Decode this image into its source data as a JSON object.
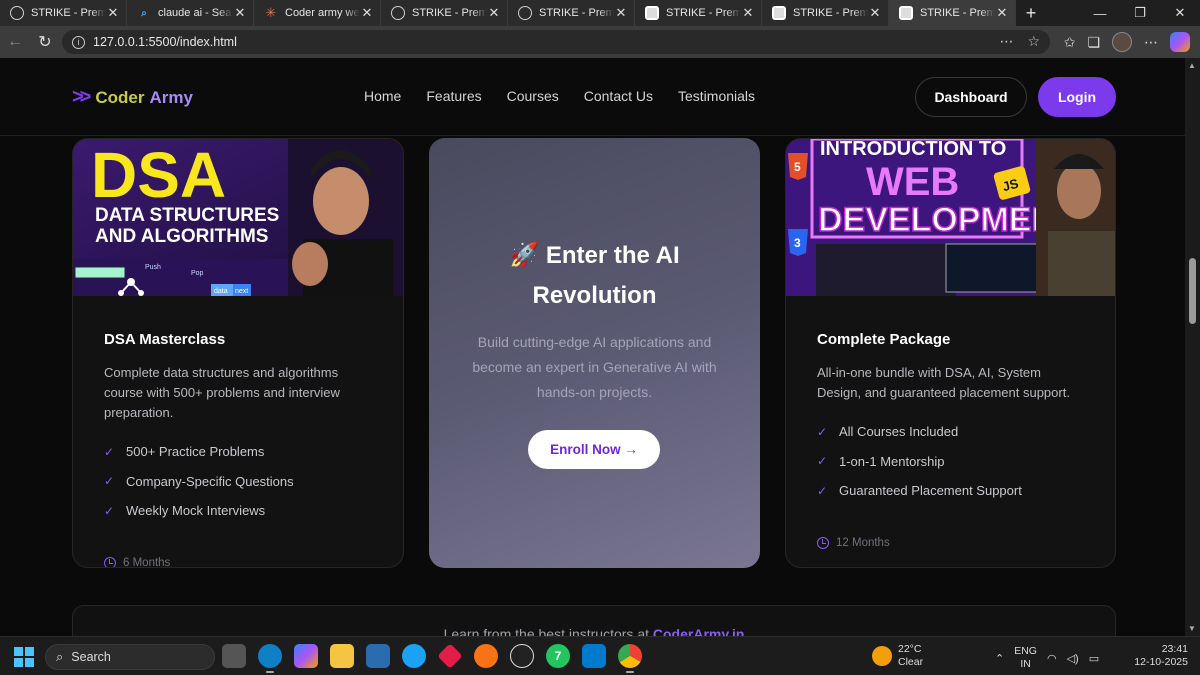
{
  "browser": {
    "tabs": [
      {
        "title": "STRIKE - Premium C",
        "icon": "globe-icon"
      },
      {
        "title": "claude ai - Search",
        "icon": "bing-icon"
      },
      {
        "title": "Coder army website",
        "icon": "claude-icon"
      },
      {
        "title": "STRIKE - Premium C",
        "icon": "globe-icon"
      },
      {
        "title": "STRIKE - Premium C",
        "icon": "globe-icon"
      },
      {
        "title": "STRIKE - Premium C",
        "icon": "avatar-icon"
      },
      {
        "title": "STRIKE - Premium C",
        "icon": "avatar-icon"
      },
      {
        "title": "STRIKE - Premium C",
        "icon": "avatar-icon"
      }
    ],
    "close_glyph": "✕",
    "new_tab_glyph": "+",
    "url": "127.0.0.1:5500/index.html"
  },
  "site": {
    "logo_word1": "Coder",
    "logo_word2": "Army",
    "nav": [
      "Home",
      "Features",
      "Courses",
      "Contact Us",
      "Testimonials"
    ],
    "dashboard_label": "Dashboard",
    "login_label": "Login"
  },
  "cards": {
    "dsa": {
      "thumb_big": "DSA",
      "thumb_sub1": "DATA STRUCTURES",
      "thumb_sub2": "AND ALGORITHMS",
      "thumb_push": "Push",
      "thumb_pop": "Pop",
      "thumb_data": "data",
      "thumb_next": "next",
      "title": "DSA Masterclass",
      "description": "Complete data structures and algorithms course with 500+ problems and interview preparation.",
      "features": [
        "500+ Practice Problems",
        "Company-Specific Questions",
        "Weekly Mock Interviews"
      ],
      "duration": "6 Months"
    },
    "ai": {
      "emoji": "🚀",
      "title_line1": "Enter the AI",
      "title_line2": "Revolution",
      "description": "Build cutting-edge AI applications and become an expert in Generative AI with hands-on projects.",
      "cta": "Enroll Now →"
    },
    "package": {
      "thumb_line1": "INTRODUCTION TO",
      "thumb_line2": "WEB",
      "thumb_line3": "DEVELOPMENT",
      "thumb_js": "JS",
      "title": "Complete Package",
      "description": "All-in-one bundle with DSA, AI, System Design, and guaranteed placement support.",
      "features": [
        "All Courses Included",
        "1-on-1 Mentorship",
        "Guaranteed Placement Support"
      ],
      "duration": "12 Months"
    }
  },
  "bottom": {
    "text": "Learn from the best instructors at ",
    "highlight": "CoderArmy.in"
  },
  "taskbar": {
    "search_label": "Search",
    "weather_badge": "7",
    "weather_temp": "22°C",
    "weather_cond": "Clear",
    "lang1": "ENG",
    "lang2": "IN",
    "time": "23:41",
    "date": "12-10-2025",
    "whatsapp_badge": "7"
  },
  "colors": {
    "accent": "#7c3aed",
    "page_bg": "#0a0a0a"
  }
}
